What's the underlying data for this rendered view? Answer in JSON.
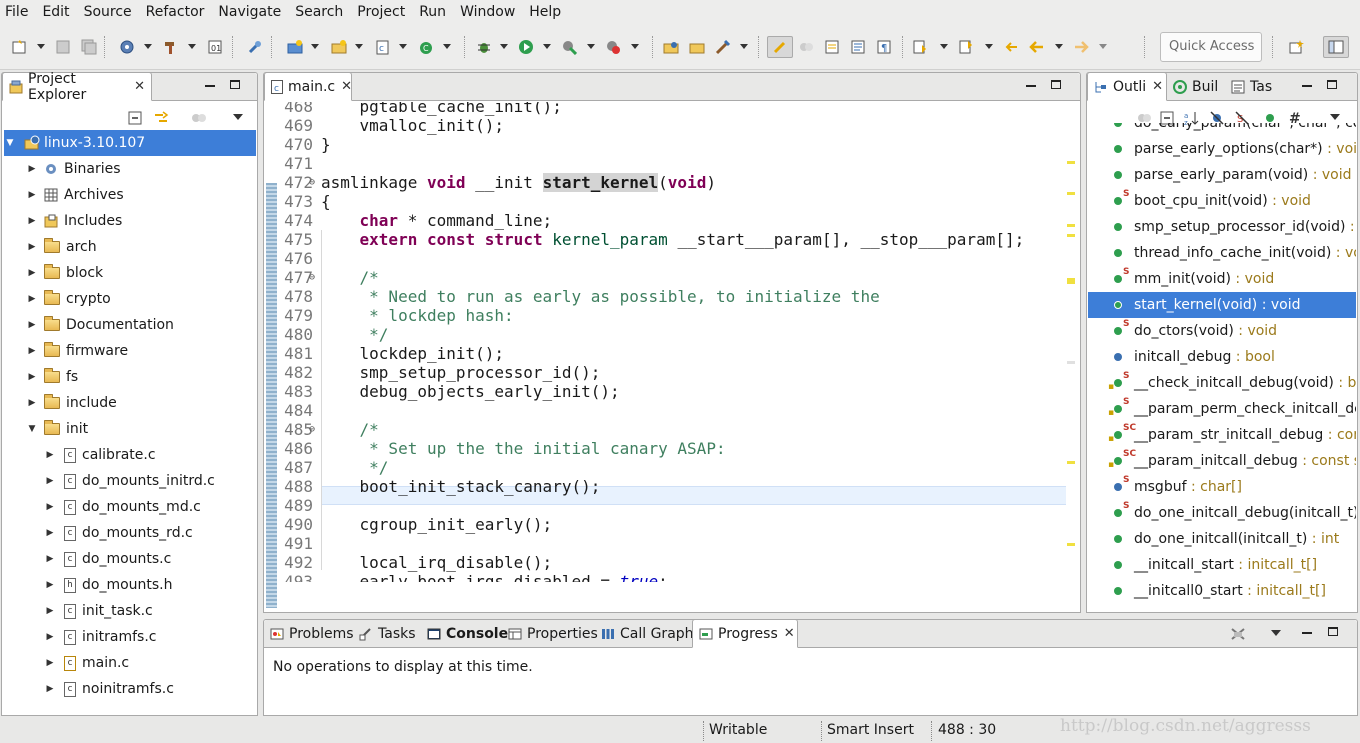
{
  "menu": [
    "File",
    "Edit",
    "Source",
    "Refactor",
    "Navigate",
    "Search",
    "Project",
    "Run",
    "Window",
    "Help"
  ],
  "toolbar": {
    "quick_access_placeholder": "Quick Access"
  },
  "project_explorer": {
    "tab_label": "Project Explorer",
    "project": "linux-3.10.107",
    "items": [
      {
        "label": "Binaries",
        "kind": "binaries",
        "level": 1,
        "expanded": false
      },
      {
        "label": "Archives",
        "kind": "archives",
        "level": 1,
        "expanded": false
      },
      {
        "label": "Includes",
        "kind": "includes",
        "level": 1,
        "expanded": false
      },
      {
        "label": "arch",
        "kind": "folder",
        "level": 1,
        "expanded": false
      },
      {
        "label": "block",
        "kind": "folder",
        "level": 1,
        "expanded": false
      },
      {
        "label": "crypto",
        "kind": "folder",
        "level": 1,
        "expanded": false
      },
      {
        "label": "Documentation",
        "kind": "folder",
        "level": 1,
        "expanded": false
      },
      {
        "label": "firmware",
        "kind": "folder",
        "level": 1,
        "expanded": false
      },
      {
        "label": "fs",
        "kind": "folder",
        "level": 1,
        "expanded": false
      },
      {
        "label": "include",
        "kind": "folder",
        "level": 1,
        "expanded": false
      },
      {
        "label": "init",
        "kind": "folder-open",
        "level": 1,
        "expanded": true
      },
      {
        "label": "calibrate.c",
        "kind": "c",
        "level": 2,
        "expanded": false
      },
      {
        "label": "do_mounts_initrd.c",
        "kind": "c",
        "level": 2,
        "expanded": false
      },
      {
        "label": "do_mounts_md.c",
        "kind": "c",
        "level": 2,
        "expanded": false
      },
      {
        "label": "do_mounts_rd.c",
        "kind": "c",
        "level": 2,
        "expanded": false
      },
      {
        "label": "do_mounts.c",
        "kind": "c",
        "level": 2,
        "expanded": false
      },
      {
        "label": "do_mounts.h",
        "kind": "h",
        "level": 2,
        "expanded": false
      },
      {
        "label": "init_task.c",
        "kind": "c",
        "level": 2,
        "expanded": false
      },
      {
        "label": "initramfs.c",
        "kind": "c",
        "level": 2,
        "expanded": false
      },
      {
        "label": "main.c",
        "kind": "c-mod",
        "level": 2,
        "expanded": false
      },
      {
        "label": "noinitramfs.c",
        "kind": "c",
        "level": 2,
        "expanded": false
      }
    ]
  },
  "editor": {
    "tab_label": "main.c",
    "lines": [
      {
        "n": "468",
        "code": "    pgtable_cache_init();"
      },
      {
        "n": "469",
        "code": "    vmalloc_init();"
      },
      {
        "n": "470",
        "code": "}"
      },
      {
        "n": "471",
        "code": ""
      },
      {
        "n": "472",
        "code": "asmlinkage void __init start_kernel(void)"
      },
      {
        "n": "473",
        "code": "{"
      },
      {
        "n": "474",
        "code": "    char * command_line;"
      },
      {
        "n": "475",
        "code": "    extern const struct kernel_param __start___param[], __stop___param[];"
      },
      {
        "n": "476",
        "code": ""
      },
      {
        "n": "477",
        "code": "    /*"
      },
      {
        "n": "478",
        "code": "     * Need to run as early as possible, to initialize the"
      },
      {
        "n": "479",
        "code": "     * lockdep hash:"
      },
      {
        "n": "480",
        "code": "     */"
      },
      {
        "n": "481",
        "code": "    lockdep_init();"
      },
      {
        "n": "482",
        "code": "    smp_setup_processor_id();"
      },
      {
        "n": "483",
        "code": "    debug_objects_early_init();"
      },
      {
        "n": "484",
        "code": ""
      },
      {
        "n": "485",
        "code": "    /*"
      },
      {
        "n": "486",
        "code": "     * Set up the the initial canary ASAP:"
      },
      {
        "n": "487",
        "code": "     */"
      },
      {
        "n": "488",
        "code": "    boot_init_stack_canary();"
      },
      {
        "n": "489",
        "code": ""
      },
      {
        "n": "490",
        "code": "    cgroup_init_early();"
      },
      {
        "n": "491",
        "code": ""
      },
      {
        "n": "492",
        "code": "    local_irq_disable();"
      },
      {
        "n": "493",
        "code": "    early_boot_irqs_disabled = true;"
      }
    ]
  },
  "outline": {
    "tabs": [
      "Outli",
      "Buil",
      "Tas"
    ],
    "items": [
      {
        "name": "do_early_param(char*, char*, cons",
        "type": "",
        "marker": "S"
      },
      {
        "name": "parse_early_options(char*)",
        "type": "void",
        "marker": ""
      },
      {
        "name": "parse_early_param(void)",
        "type": "void",
        "marker": ""
      },
      {
        "name": "boot_cpu_init(void)",
        "type": "void",
        "marker": "S"
      },
      {
        "name": "smp_setup_processor_id(void)",
        "type": "vo",
        "marker": ""
      },
      {
        "name": "thread_info_cache_init(void)",
        "type": "void",
        "marker": ""
      },
      {
        "name": "mm_init(void)",
        "type": "void",
        "marker": "S"
      },
      {
        "name": "start_kernel(void)",
        "type": "void",
        "marker": "",
        "selected": true
      },
      {
        "name": "do_ctors(void)",
        "type": "void",
        "marker": "S"
      },
      {
        "name": "initcall_debug",
        "type": "bool",
        "marker": ""
      },
      {
        "name": "__check_initcall_debug(void)",
        "type": "boo",
        "marker": "S"
      },
      {
        "name": "__param_perm_check_initcall_deb",
        "type": "",
        "marker": "S"
      },
      {
        "name": "__param_str_initcall_debug",
        "type": "const",
        "marker": "SC"
      },
      {
        "name": "__param_initcall_debug",
        "type": "const str",
        "marker": "SC"
      },
      {
        "name": "msgbuf",
        "type": "char[]",
        "marker": "S"
      },
      {
        "name": "do_one_initcall_debug(initcall_t)",
        "type": "",
        "marker": "S"
      },
      {
        "name": "do_one_initcall(initcall_t)",
        "type": "int",
        "marker": ""
      },
      {
        "name": "__initcall_start",
        "type": "initcall_t[]",
        "marker": ""
      },
      {
        "name": "__initcall0_start",
        "type": "initcall_t[]",
        "marker": ""
      }
    ]
  },
  "bottom": {
    "tabs": [
      "Problems",
      "Tasks",
      "Console",
      "Properties",
      "Call Graph",
      "Progress"
    ],
    "active_tab": "Progress",
    "message": "No operations to display at this time."
  },
  "status": {
    "mode": "Writable",
    "insert": "Smart Insert",
    "position": "488 : 30",
    "watermark": "http://blog.csdn.net/aggresss"
  }
}
